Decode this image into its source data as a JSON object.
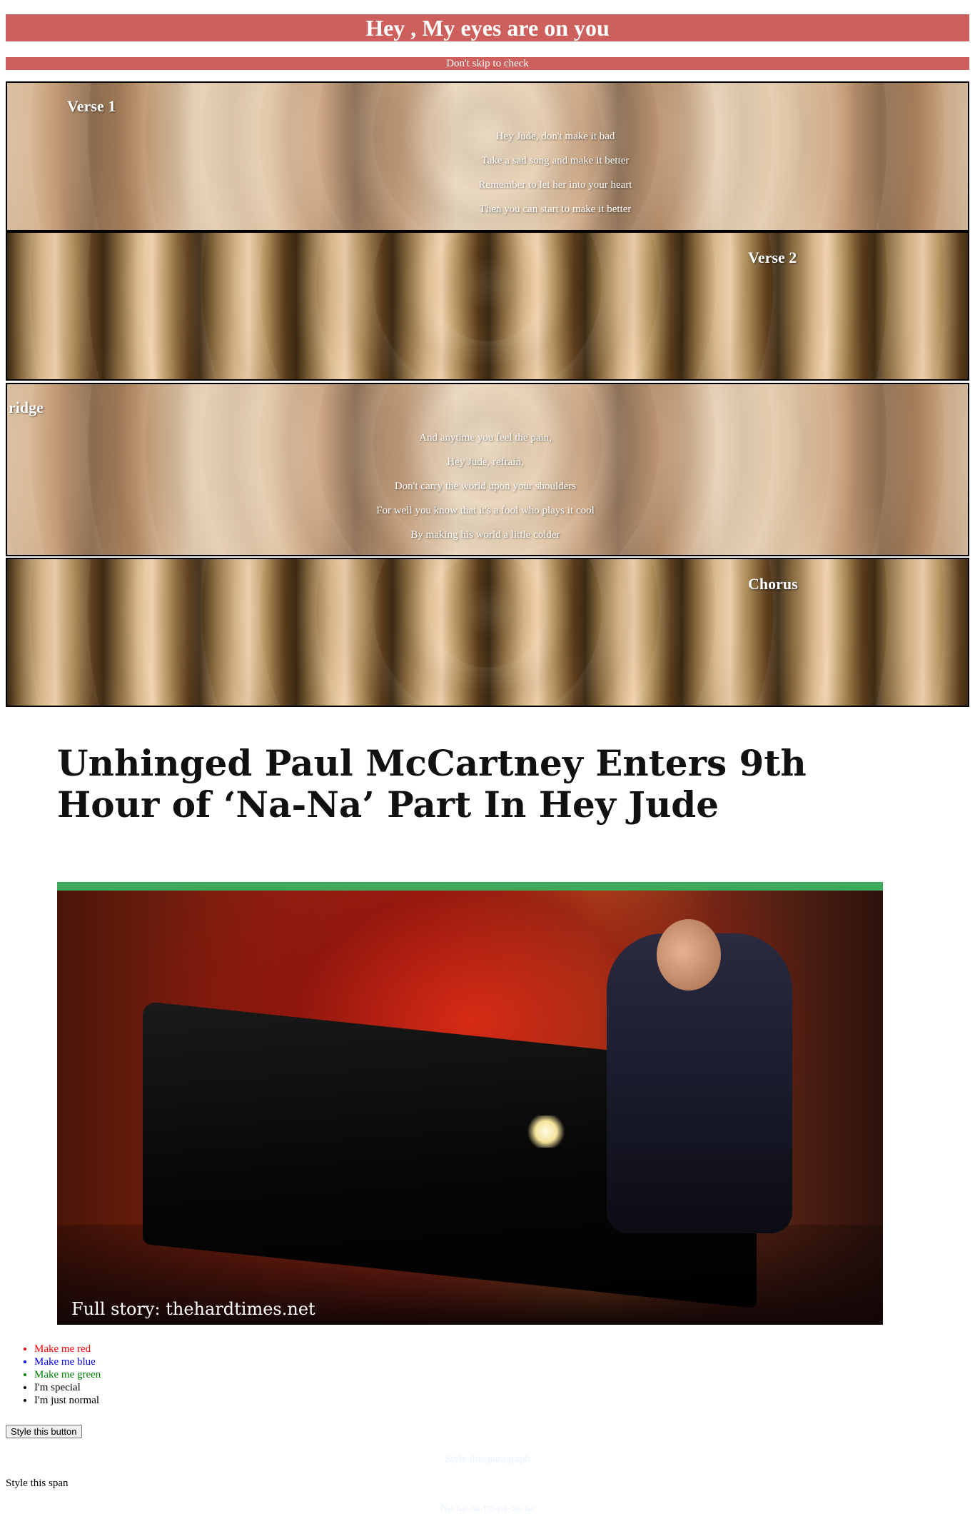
{
  "banner": {
    "title": "Hey , My eyes are on you",
    "subtitle": "Don't skip to check"
  },
  "sections": {
    "verse1": {
      "heading": "Verse 1",
      "lines": [
        "Hey Jude, don't make it bad",
        "Take a sad song and make it better",
        "Remember to let her into your heart",
        "Then you can start to make it better"
      ]
    },
    "verse2": {
      "heading": "Verse 2"
    },
    "bridge": {
      "heading": "ridge",
      "lines": [
        "And anytime you feel the pain,",
        "Hey Jude, refrain,",
        "Don't carry the world upon your shoulders",
        "For well you know that it's a fool who plays it cool",
        "By making his world a little colder"
      ]
    },
    "chorus": {
      "heading": "Chorus"
    }
  },
  "article": {
    "title": "Unhinged Paul McCartney Enters 9th Hour of ‘Na-Na’ Part In Hey Jude",
    "photo_caption": "Full story: thehardtimes.net",
    "accent_color": "#3ea95a"
  },
  "list_items": [
    "Make me red",
    "Make me blue",
    "Make me green",
    "I'm special",
    "I'm just normal"
  ],
  "button_label": "Style this button",
  "paragraph_text": "Style this paragraph",
  "span_text": "Style this span",
  "na_text": "Na-na-na-na-na-na-na",
  "colors": {
    "banner": "#cd5f5c",
    "red": "#ff0000",
    "blue": "#0000ff",
    "green": "#008000"
  }
}
